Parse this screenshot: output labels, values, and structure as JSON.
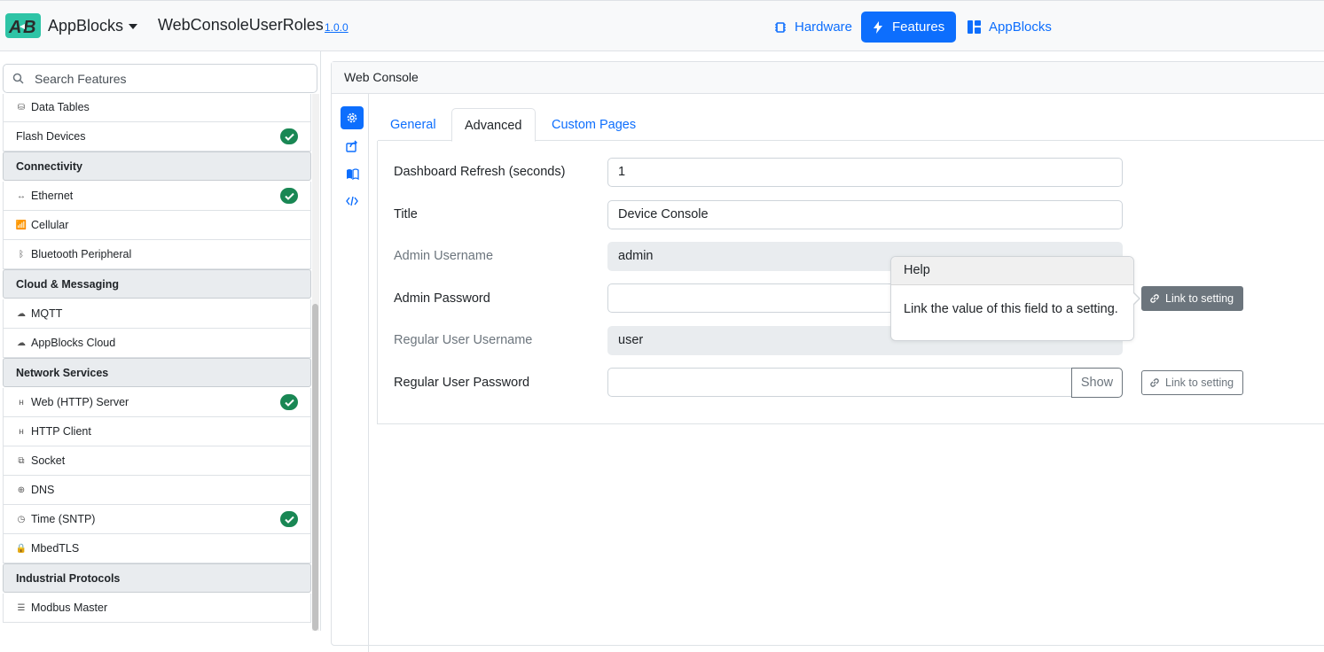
{
  "header": {
    "logo_text": "AB",
    "brand": "AppBlocks",
    "project": "WebConsoleUserRoles",
    "version": "1.0.0",
    "nav": [
      {
        "label": "Hardware",
        "icon": "chip-icon",
        "active": false
      },
      {
        "label": "Features",
        "icon": "lightning-icon",
        "active": true
      },
      {
        "label": "AppBlocks",
        "icon": "grid-icon",
        "active": false
      }
    ]
  },
  "sidebar": {
    "search_placeholder": "Search Features",
    "rows": [
      {
        "label": "Data Tables",
        "icon": "database-icon",
        "glyph": "⛁"
      },
      {
        "label": "Flash Devices",
        "checked": true
      },
      {
        "category": "Connectivity"
      },
      {
        "label": "Ethernet",
        "icon": "arrows-icon",
        "glyph": "↔",
        "checked": true
      },
      {
        "label": "Cellular",
        "icon": "antenna-icon",
        "glyph": "📶"
      },
      {
        "label": "Bluetooth Peripheral",
        "icon": "bluetooth-icon",
        "glyph": "ᛒ"
      },
      {
        "category": "Cloud & Messaging"
      },
      {
        "label": "MQTT",
        "icon": "cloud-upload-icon",
        "glyph": "☁"
      },
      {
        "label": "AppBlocks Cloud",
        "icon": "cloud-icon",
        "glyph": "☁"
      },
      {
        "category": "Network Services"
      },
      {
        "label": "Web (HTTP) Server",
        "icon": "http-icon",
        "glyph": "ʜ",
        "checked": true
      },
      {
        "label": "HTTP Client",
        "icon": "http-icon",
        "glyph": "ʜ"
      },
      {
        "label": "Socket",
        "icon": "network-icon",
        "glyph": "⧉"
      },
      {
        "label": "DNS",
        "icon": "globe-icon",
        "glyph": "⊕"
      },
      {
        "label": "Time (SNTP)",
        "icon": "clock-icon",
        "glyph": "◷",
        "checked": true
      },
      {
        "label": "MbedTLS",
        "icon": "lock-icon",
        "glyph": "🔒"
      },
      {
        "category": "Industrial Protocols"
      },
      {
        "label": "Modbus Master",
        "icon": "modbus-icon",
        "glyph": "☰"
      }
    ]
  },
  "panel": {
    "title": "Web Console",
    "side_icons": [
      "gear-icon",
      "share-icon",
      "book-icon",
      "code-icon"
    ],
    "tabs": [
      {
        "label": "General",
        "active": false
      },
      {
        "label": "Advanced",
        "active": true
      },
      {
        "label": "Custom Pages",
        "active": false
      }
    ],
    "fields": [
      {
        "label": "Dashboard Refresh (seconds)",
        "value": "1",
        "disabled": false
      },
      {
        "label": "Title",
        "value": "Device Console",
        "disabled": false
      },
      {
        "label": "Admin Username",
        "value": "admin",
        "disabled": true
      },
      {
        "label": "Admin Password",
        "value": "",
        "disabled": false
      },
      {
        "label": "Regular User Username",
        "value": "user",
        "disabled": true
      },
      {
        "label": "Regular User Password",
        "value": "",
        "disabled": false
      }
    ],
    "show_button": "Show",
    "link_button": "Link to setting",
    "help": {
      "title": "Help",
      "body": "Link the value of this field to a setting."
    }
  },
  "colors": {
    "primary": "#0d6efd",
    "success": "#198754",
    "secondary": "#6c757d"
  }
}
